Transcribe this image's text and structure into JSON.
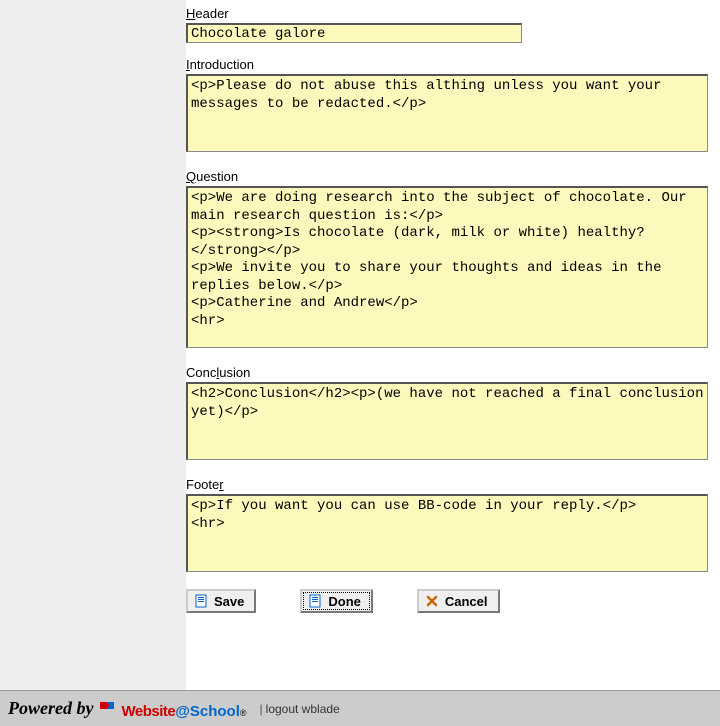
{
  "fields": {
    "header": {
      "label_pre": "",
      "label_hot": "H",
      "label_post": "eader",
      "value": "Chocolate galore"
    },
    "introduction": {
      "label_pre": "",
      "label_hot": "I",
      "label_post": "ntroduction",
      "value": "<p>Please do not abuse this althing unless you want your messages to be redacted.</p>"
    },
    "question": {
      "label_pre": "",
      "label_hot": "Q",
      "label_post": "uestion",
      "value": "<p>We are doing research into the subject of chocolate. Our main research question is:</p>\n<p><strong>Is chocolate (dark, milk or white) healthy?</strong></p>\n<p>We invite you to share your thoughts and ideas in the replies below.</p>\n<p>Catherine and Andrew</p>\n<hr>"
    },
    "conclusion": {
      "label_pre": "Conc",
      "label_hot": "l",
      "label_post": "usion",
      "value": "<h2>Conclusion</h2><p>(we have not reached a final conclusion yet)</p>"
    },
    "footer": {
      "label_pre": "Foote",
      "label_hot": "r",
      "label_post": "",
      "value": "<p>If you want you can use BB-code in your reply.</p>\n<hr>"
    }
  },
  "buttons": {
    "save": "Save",
    "done": "Done",
    "cancel": "Cancel"
  },
  "footerbar": {
    "powered_by": "Powered by",
    "logo_website": "Website",
    "logo_at": "@",
    "logo_school": "School",
    "separator": "|",
    "logout_text": "logout wblade"
  }
}
